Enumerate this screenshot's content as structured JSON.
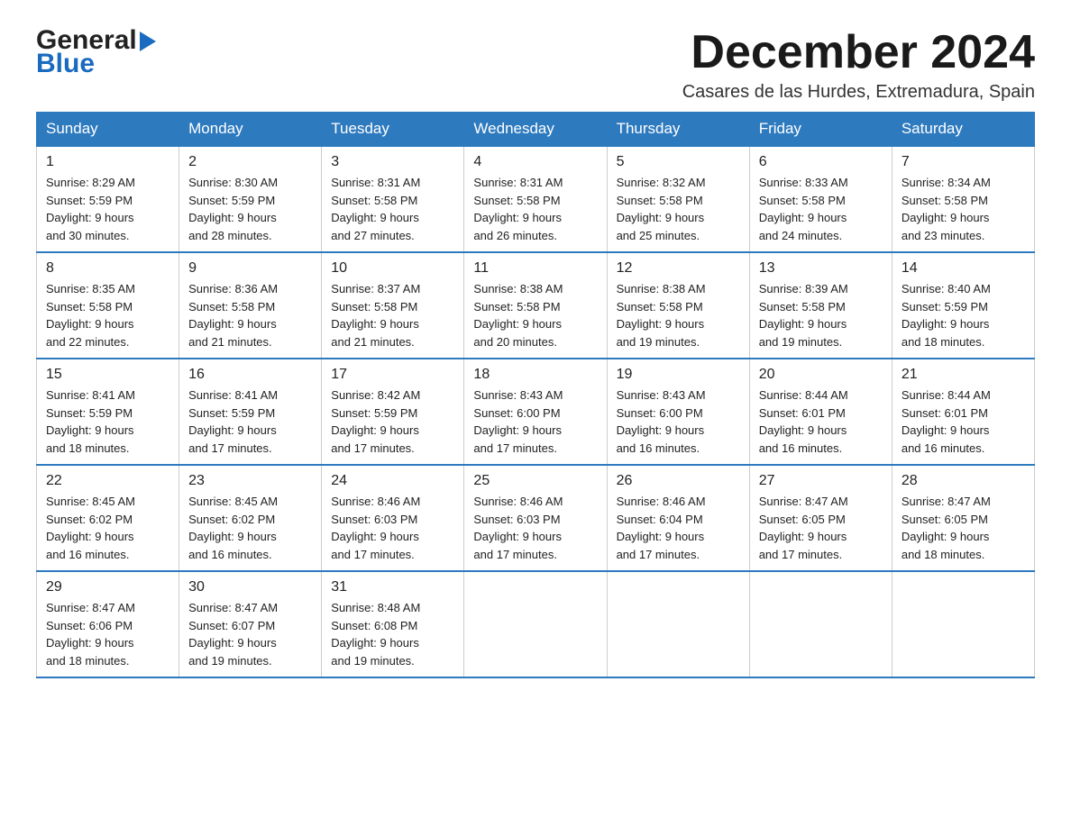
{
  "header": {
    "logo_general": "General",
    "logo_blue": "Blue",
    "month_title": "December 2024",
    "location": "Casares de las Hurdes, Extremadura, Spain"
  },
  "weekdays": [
    "Sunday",
    "Monday",
    "Tuesday",
    "Wednesday",
    "Thursday",
    "Friday",
    "Saturday"
  ],
  "weeks": [
    [
      {
        "day": "1",
        "info": "Sunrise: 8:29 AM\nSunset: 5:59 PM\nDaylight: 9 hours\nand 30 minutes."
      },
      {
        "day": "2",
        "info": "Sunrise: 8:30 AM\nSunset: 5:59 PM\nDaylight: 9 hours\nand 28 minutes."
      },
      {
        "day": "3",
        "info": "Sunrise: 8:31 AM\nSunset: 5:58 PM\nDaylight: 9 hours\nand 27 minutes."
      },
      {
        "day": "4",
        "info": "Sunrise: 8:31 AM\nSunset: 5:58 PM\nDaylight: 9 hours\nand 26 minutes."
      },
      {
        "day": "5",
        "info": "Sunrise: 8:32 AM\nSunset: 5:58 PM\nDaylight: 9 hours\nand 25 minutes."
      },
      {
        "day": "6",
        "info": "Sunrise: 8:33 AM\nSunset: 5:58 PM\nDaylight: 9 hours\nand 24 minutes."
      },
      {
        "day": "7",
        "info": "Sunrise: 8:34 AM\nSunset: 5:58 PM\nDaylight: 9 hours\nand 23 minutes."
      }
    ],
    [
      {
        "day": "8",
        "info": "Sunrise: 8:35 AM\nSunset: 5:58 PM\nDaylight: 9 hours\nand 22 minutes."
      },
      {
        "day": "9",
        "info": "Sunrise: 8:36 AM\nSunset: 5:58 PM\nDaylight: 9 hours\nand 21 minutes."
      },
      {
        "day": "10",
        "info": "Sunrise: 8:37 AM\nSunset: 5:58 PM\nDaylight: 9 hours\nand 21 minutes."
      },
      {
        "day": "11",
        "info": "Sunrise: 8:38 AM\nSunset: 5:58 PM\nDaylight: 9 hours\nand 20 minutes."
      },
      {
        "day": "12",
        "info": "Sunrise: 8:38 AM\nSunset: 5:58 PM\nDaylight: 9 hours\nand 19 minutes."
      },
      {
        "day": "13",
        "info": "Sunrise: 8:39 AM\nSunset: 5:58 PM\nDaylight: 9 hours\nand 19 minutes."
      },
      {
        "day": "14",
        "info": "Sunrise: 8:40 AM\nSunset: 5:59 PM\nDaylight: 9 hours\nand 18 minutes."
      }
    ],
    [
      {
        "day": "15",
        "info": "Sunrise: 8:41 AM\nSunset: 5:59 PM\nDaylight: 9 hours\nand 18 minutes."
      },
      {
        "day": "16",
        "info": "Sunrise: 8:41 AM\nSunset: 5:59 PM\nDaylight: 9 hours\nand 17 minutes."
      },
      {
        "day": "17",
        "info": "Sunrise: 8:42 AM\nSunset: 5:59 PM\nDaylight: 9 hours\nand 17 minutes."
      },
      {
        "day": "18",
        "info": "Sunrise: 8:43 AM\nSunset: 6:00 PM\nDaylight: 9 hours\nand 17 minutes."
      },
      {
        "day": "19",
        "info": "Sunrise: 8:43 AM\nSunset: 6:00 PM\nDaylight: 9 hours\nand 16 minutes."
      },
      {
        "day": "20",
        "info": "Sunrise: 8:44 AM\nSunset: 6:01 PM\nDaylight: 9 hours\nand 16 minutes."
      },
      {
        "day": "21",
        "info": "Sunrise: 8:44 AM\nSunset: 6:01 PM\nDaylight: 9 hours\nand 16 minutes."
      }
    ],
    [
      {
        "day": "22",
        "info": "Sunrise: 8:45 AM\nSunset: 6:02 PM\nDaylight: 9 hours\nand 16 minutes."
      },
      {
        "day": "23",
        "info": "Sunrise: 8:45 AM\nSunset: 6:02 PM\nDaylight: 9 hours\nand 16 minutes."
      },
      {
        "day": "24",
        "info": "Sunrise: 8:46 AM\nSunset: 6:03 PM\nDaylight: 9 hours\nand 17 minutes."
      },
      {
        "day": "25",
        "info": "Sunrise: 8:46 AM\nSunset: 6:03 PM\nDaylight: 9 hours\nand 17 minutes."
      },
      {
        "day": "26",
        "info": "Sunrise: 8:46 AM\nSunset: 6:04 PM\nDaylight: 9 hours\nand 17 minutes."
      },
      {
        "day": "27",
        "info": "Sunrise: 8:47 AM\nSunset: 6:05 PM\nDaylight: 9 hours\nand 17 minutes."
      },
      {
        "day": "28",
        "info": "Sunrise: 8:47 AM\nSunset: 6:05 PM\nDaylight: 9 hours\nand 18 minutes."
      }
    ],
    [
      {
        "day": "29",
        "info": "Sunrise: 8:47 AM\nSunset: 6:06 PM\nDaylight: 9 hours\nand 18 minutes."
      },
      {
        "day": "30",
        "info": "Sunrise: 8:47 AM\nSunset: 6:07 PM\nDaylight: 9 hours\nand 19 minutes."
      },
      {
        "day": "31",
        "info": "Sunrise: 8:48 AM\nSunset: 6:08 PM\nDaylight: 9 hours\nand 19 minutes."
      },
      {
        "day": "",
        "info": ""
      },
      {
        "day": "",
        "info": ""
      },
      {
        "day": "",
        "info": ""
      },
      {
        "day": "",
        "info": ""
      }
    ]
  ]
}
